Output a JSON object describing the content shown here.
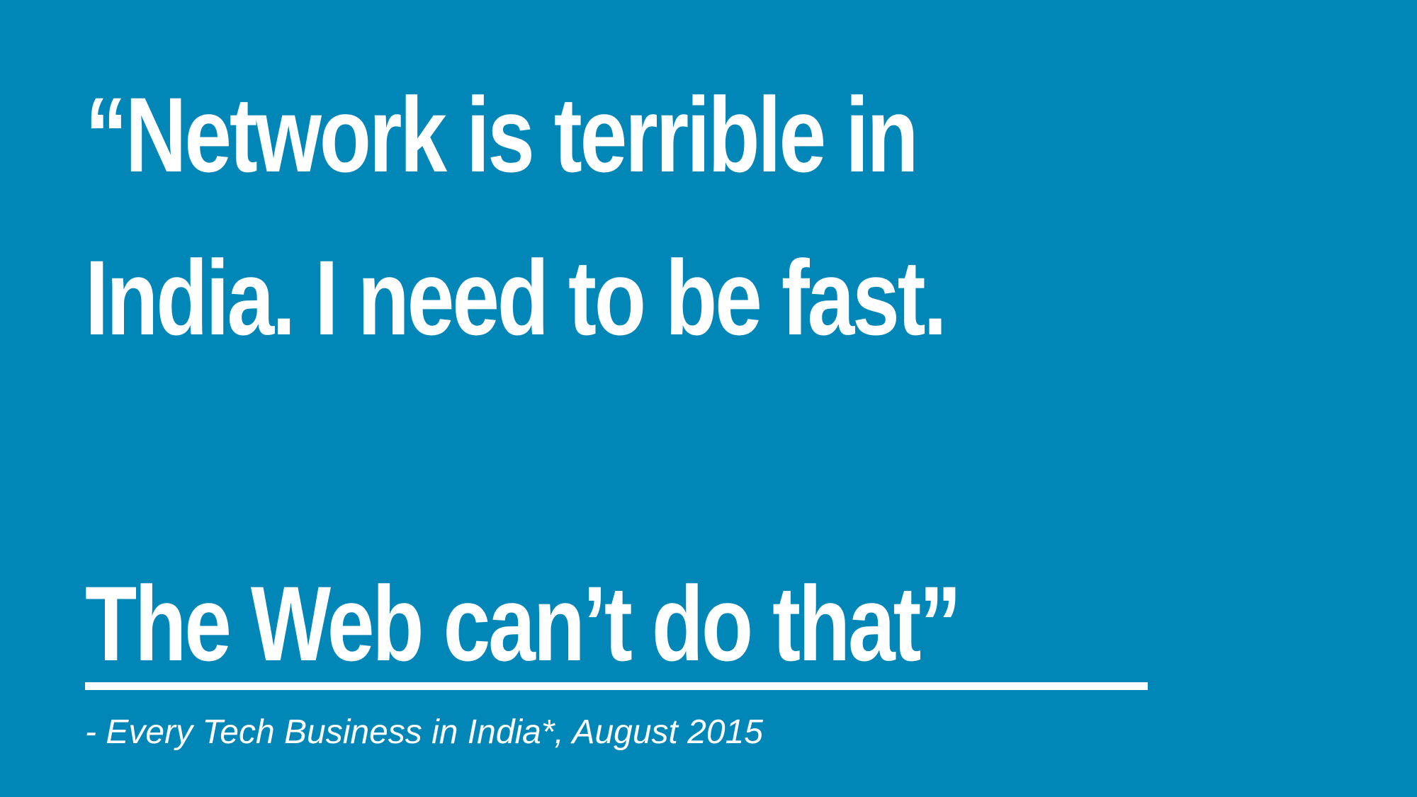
{
  "slide": {
    "background_color": "#0086b7",
    "text_color": "#ffffff",
    "quote": {
      "line1": "“Network is terrible in",
      "line2": "India. I need to be fast.",
      "line3_underlined": "The Web can’t do that",
      "line3_closing_mark": "”"
    },
    "attribution": "- Every Tech Business in India*, August 2015"
  }
}
